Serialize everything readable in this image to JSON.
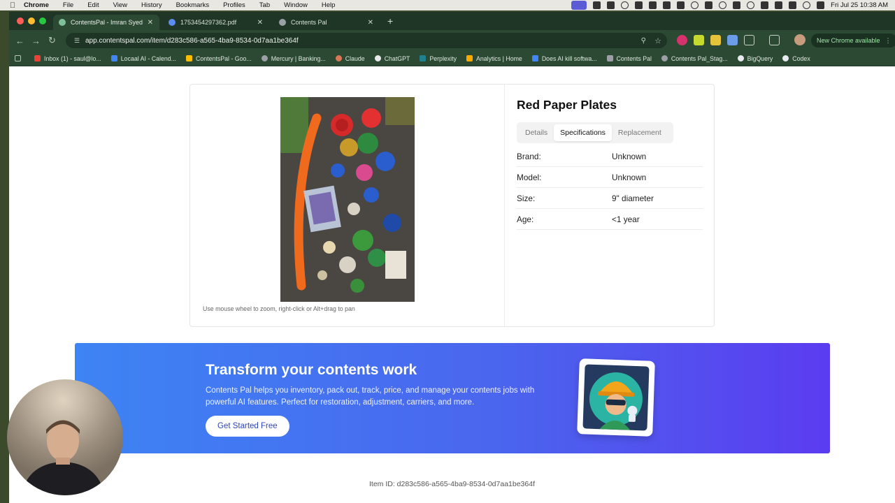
{
  "menubar": {
    "app": "Chrome",
    "items": [
      "File",
      "Edit",
      "View",
      "History",
      "Bookmarks",
      "Profiles",
      "Tab",
      "Window",
      "Help"
    ],
    "clock": "Fri Jul 25  10:38 AM"
  },
  "tabs": [
    {
      "title": "ContentsPal - Imran Syed - In",
      "active": true
    },
    {
      "title": "1753454297362.pdf",
      "active": false
    },
    {
      "title": "Contents Pal",
      "active": false
    }
  ],
  "address": {
    "url": "app.contentspal.com/item/d283c586-a565-4ba9-8534-0d7aa1be364f"
  },
  "update_button": "New Chrome available",
  "bookmarks": [
    {
      "label": "Inbox (1) - saul@lo...",
      "color": "#ea4335"
    },
    {
      "label": "Locaal AI - Calend...",
      "color": "#4285f4"
    },
    {
      "label": "ContentsPal - Goo...",
      "color": "#fbbc04"
    },
    {
      "label": "Mercury | Banking...",
      "color": "#9aa0a6"
    },
    {
      "label": "Claude",
      "color": "#d97757"
    },
    {
      "label": "ChatGPT",
      "color": "#e8eaed"
    },
    {
      "label": "Perplexity",
      "color": "#20808d"
    },
    {
      "label": "Analytics | Home",
      "color": "#f9ab00"
    },
    {
      "label": "Does AI kill softwa...",
      "color": "#4285f4"
    },
    {
      "label": "Contents Pal",
      "color": "#9aa0a6"
    },
    {
      "label": "Contents Pal_Stag...",
      "color": "#9aa0a6"
    },
    {
      "label": "BigQuery",
      "color": "#e8eaed"
    },
    {
      "label": "Codex",
      "color": "#e8eaed"
    }
  ],
  "item": {
    "title": "Red Paper Plates",
    "hint": "Use mouse wheel to zoom, right-click or Alt+drag to pan",
    "tabs": [
      "Details",
      "Specifications",
      "Replacement"
    ],
    "active_tab": "Specifications",
    "specs": [
      {
        "label": "Brand:",
        "value": "Unknown"
      },
      {
        "label": "Model:",
        "value": "Unknown"
      },
      {
        "label": "Size:",
        "value": "9\" diameter"
      },
      {
        "label": "Age:",
        "value": "<1 year"
      }
    ]
  },
  "banner": {
    "heading": "Transform your contents work",
    "body": "Contents Pal helps you inventory, pack out, track, price, and manage your contents jobs with powerful AI features. Perfect for restoration, adjustment, carriers, and more.",
    "cta": "Get Started Free"
  },
  "footer": {
    "item_id": "Item ID: d283c586-a565-4ba9-8534-0d7aa1be364f"
  }
}
